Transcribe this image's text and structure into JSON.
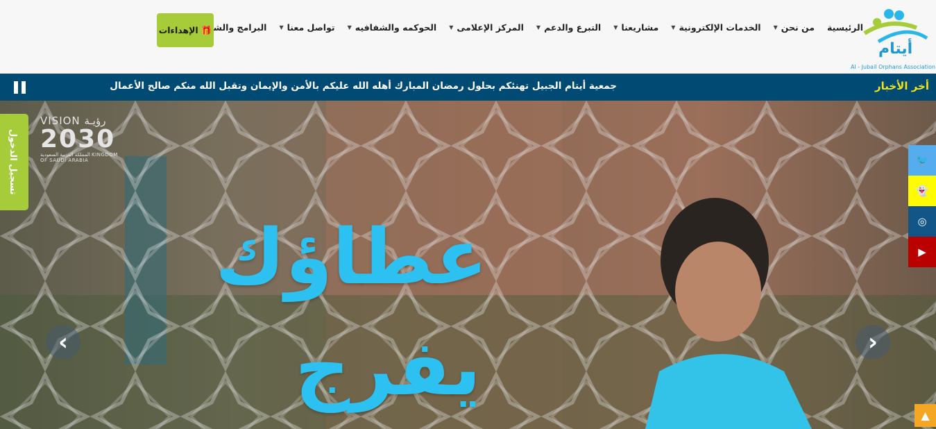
{
  "header": {
    "logo_title": "أيتام",
    "logo_subtitle": "Al - Jubail Orphans Association",
    "nav": [
      {
        "label": "الرئيسية",
        "caret": false
      },
      {
        "label": "من نحن",
        "caret": true
      },
      {
        "label": "الخدمات الإلكترونية",
        "caret": true
      },
      {
        "label": "مشاريعنا",
        "caret": true
      },
      {
        "label": "التبرع والدعم",
        "caret": true
      },
      {
        "label": "المركز الإعلامى",
        "caret": true
      },
      {
        "label": "الحوكمه والشفافيه",
        "caret": true
      },
      {
        "label": "تواصل معنا",
        "caret": true
      },
      {
        "label": "البرامج والشراكات",
        "caret": true
      }
    ],
    "gifts_label": "الإهداءات",
    "gifts_icon": "🎁"
  },
  "news": {
    "label": "أخر الأخبار",
    "text": "جمعية أيتام الجبيل تهنئكم بحلول رمضان المبارك أهله الله عليكم بالأمن والإيمان وتقبل الله منكم صالح الأعمال"
  },
  "hero": {
    "headline_1": "عطاؤك",
    "headline_2": "يفرج",
    "vision_top": "VISION رؤيـة",
    "vision_year": "2030",
    "vision_bottom": "المملكة العربية السعودية KINGDOM OF SAUDI ARABIA"
  },
  "login_label": "تسجيل الدخول",
  "social": [
    {
      "name": "twitter-icon",
      "glyph": "🐦",
      "color": "#55acee"
    },
    {
      "name": "snapchat-icon",
      "glyph": "👻",
      "color": "#fffc00"
    },
    {
      "name": "instagram-icon",
      "glyph": "◎",
      "color": "#125688"
    },
    {
      "name": "youtube-icon",
      "glyph": "▶",
      "color": "#bb0000"
    }
  ],
  "arrows": {
    "prev": "‹",
    "next": "›"
  },
  "to_top": "▲"
}
